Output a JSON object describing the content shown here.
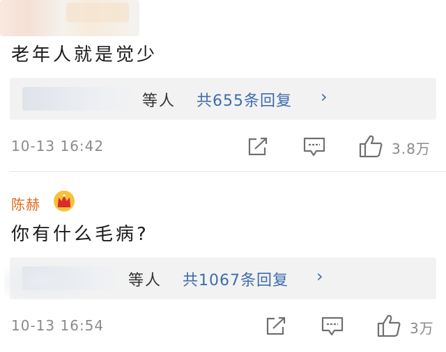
{
  "comment1": {
    "text": "老年人就是觉少",
    "replies": {
      "tail_text": "等人",
      "count_text": "共655条回复",
      "chevron": "›"
    },
    "timestamp": "10-13 16:42",
    "actions": {
      "share_icon": "share-icon",
      "comment_icon": "comment-icon",
      "like_icon": "thumbs-up-icon",
      "like_count": "3.8万"
    }
  },
  "comment2": {
    "username": "陈赫",
    "badge_icon": "crown-icon",
    "text": "你有什么毛病?",
    "replies": {
      "tail_text": "等人",
      "count_text": "共1067条回复",
      "chevron": "›"
    },
    "timestamp": "10-13 16:54",
    "actions": {
      "share_icon": "share-icon",
      "comment_icon": "comment-icon",
      "like_icon": "thumbs-up-icon",
      "like_count": "3万"
    }
  },
  "colors": {
    "link": "#3d6cad",
    "username": "#e06a1c",
    "meta": "#8a8a8a",
    "reply_bg": "#f2f2f2"
  }
}
